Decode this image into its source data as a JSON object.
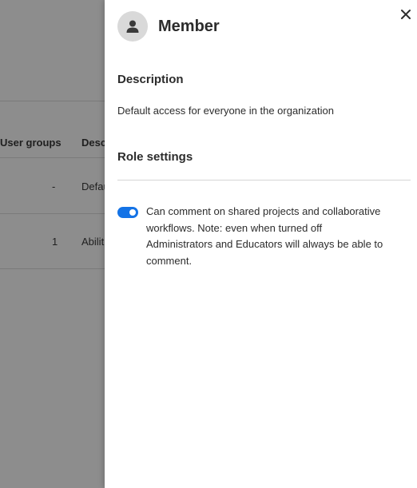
{
  "background_table": {
    "headers": {
      "user_groups": "User groups",
      "description": "Desc"
    },
    "rows": [
      {
        "user_groups": "-",
        "description": "Defau"
      },
      {
        "user_groups": "1",
        "description": "Abilit"
      }
    ]
  },
  "panel": {
    "title": "Member",
    "avatar_icon": "user-icon",
    "close_icon": "close-icon",
    "description_heading": "Description",
    "description_text": "Default access for everyone in the organization",
    "role_settings_heading": "Role settings",
    "settings": [
      {
        "enabled": true,
        "label": "Can comment on shared projects and collaborative workflows. Note: even when turned off Administrators and Educators will always be able to comment."
      }
    ]
  },
  "colors": {
    "accent": "#1473e6",
    "overlay": "#8d8d8d",
    "panel_bg": "#ffffff"
  }
}
